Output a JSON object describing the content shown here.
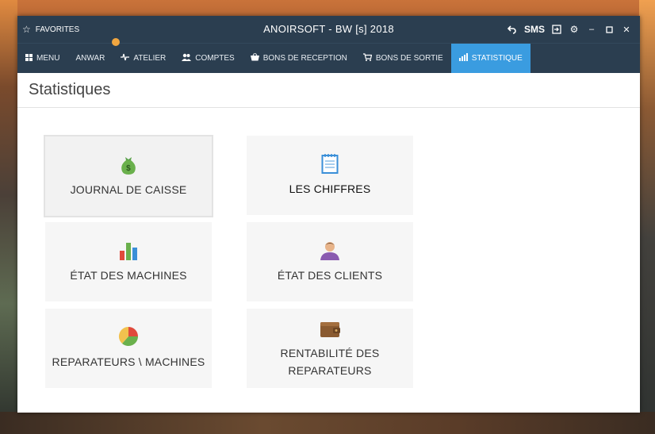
{
  "titlebar": {
    "favorites_label": "FAVORITES",
    "title": "ANOIRSOFT - BW [s] 2018",
    "sms_label": "SMS"
  },
  "nav": {
    "menu": "MENU",
    "anwar": "ANWAR",
    "atelier": "ATELIER",
    "comptes": "COMPTES",
    "bons_reception": "BONS DE RECEPTION",
    "bons_sortie": "BONS DE SORTIE",
    "statistique": "STATISTIQUE"
  },
  "page": {
    "title": "Statistiques"
  },
  "tiles": {
    "journal_caisse": "JOURNAL DE CAISSE",
    "les_chiffres": "LES CHIFFRES",
    "etat_machines": "ÉTAT DES MACHINES",
    "etat_clients": "ÉTAT DES CLIENTS",
    "reparateurs_machines": "REPARATEURS \\ MACHINES",
    "rentabilite_line1": "RENTABILITÉ DES",
    "rentabilite_line2": "REPARATEURS"
  },
  "colors": {
    "titlebar_bg": "#2b3e50",
    "active_tab": "#3a9ce0",
    "badge": "#f0a640",
    "tile_bg": "#f6f6f6"
  },
  "icons": {
    "journal_caisse": "money-bag-icon",
    "les_chiffres": "notepad-icon",
    "etat_machines": "bar-chart-icon",
    "etat_clients": "user-icon",
    "reparateurs_machines": "pie-chart-icon",
    "rentabilite": "wallet-icon"
  }
}
